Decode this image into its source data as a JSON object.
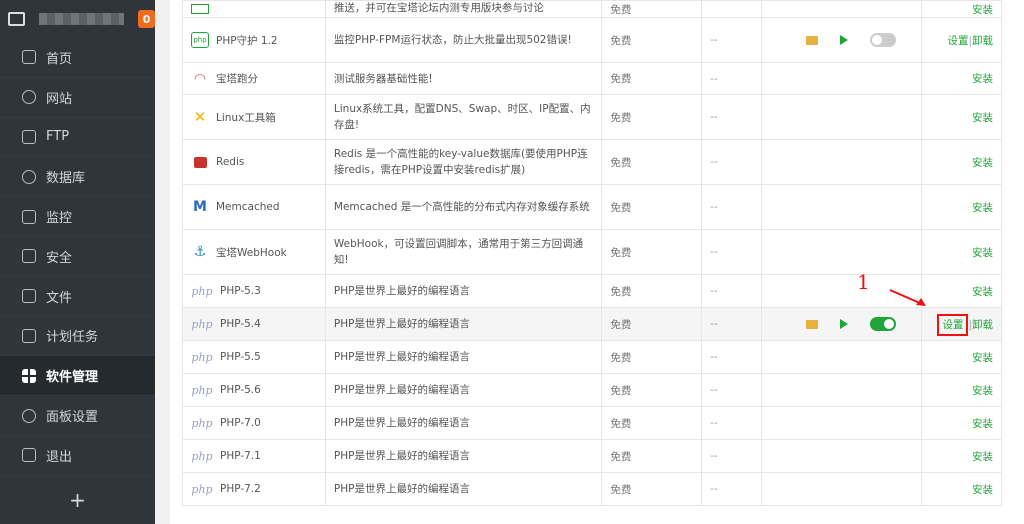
{
  "sidebar": {
    "badge": "0",
    "menu": [
      {
        "label": "首页",
        "icon": "home-icon"
      },
      {
        "label": "网站",
        "icon": "globe-icon"
      },
      {
        "label": "FTP",
        "icon": "ftp-icon"
      },
      {
        "label": "数据库",
        "icon": "database-icon"
      },
      {
        "label": "监控",
        "icon": "monitor-icon"
      },
      {
        "label": "安全",
        "icon": "shield-icon"
      },
      {
        "label": "文件",
        "icon": "folder-icon"
      },
      {
        "label": "计划任务",
        "icon": "calendar-icon"
      },
      {
        "label": "软件管理",
        "icon": "grid-icon",
        "active": true
      },
      {
        "label": "面板设置",
        "icon": "gear-icon"
      },
      {
        "label": "退出",
        "icon": "logout-icon"
      }
    ],
    "add": "+"
  },
  "rows": [
    {
      "name": "",
      "desc": "推送，并可在宝塔论坛内测专用版块参与讨论",
      "price": "免费",
      "expire": "",
      "action": "安装"
    },
    {
      "name": "PHP守护 1.2",
      "desc": "监控PHP-FPM运行状态，防止大批量出现502错误!",
      "price": "免费",
      "expire": "--",
      "action1": "设置",
      "sep": "|",
      "action2": "卸载"
    },
    {
      "name": "宝塔跑分",
      "desc": "测试服务器基础性能!",
      "price": "免费",
      "expire": "--",
      "action": "安装"
    },
    {
      "name": "Linux工具箱",
      "desc": "Linux系统工具，配置DNS、Swap、时区、IP配置、内存盘!",
      "price": "免费",
      "expire": "--",
      "action": "安装"
    },
    {
      "name": "Redis",
      "desc": "Redis 是一个高性能的key-value数据库(要使用PHP连接redis，需在PHP设置中安装redis扩展)",
      "price": "免费",
      "expire": "--",
      "action": "安装"
    },
    {
      "name": "Memcached",
      "desc": "Memcached 是一个高性能的分布式内存对象缓存系统",
      "price": "免费",
      "expire": "--",
      "action": "安装"
    },
    {
      "name": "宝塔WebHook",
      "desc": "WebHook，可设置回调脚本，通常用于第三方回调通知!",
      "price": "免费",
      "expire": "--",
      "action": "安装"
    },
    {
      "name": "PHP-5.3",
      "desc": "PHP是世界上最好的编程语言",
      "price": "免费",
      "expire": "--",
      "action": "安装"
    },
    {
      "name": "PHP-5.4",
      "desc": "PHP是世界上最好的编程语言",
      "price": "免费",
      "expire": "--",
      "action1": "设置",
      "sep": "|",
      "action2": "卸载"
    },
    {
      "name": "PHP-5.5",
      "desc": "PHP是世界上最好的编程语言",
      "price": "免费",
      "expire": "--",
      "action": "安装"
    },
    {
      "name": "PHP-5.6",
      "desc": "PHP是世界上最好的编程语言",
      "price": "免费",
      "expire": "--",
      "action": "安装"
    },
    {
      "name": "PHP-7.0",
      "desc": "PHP是世界上最好的编程语言",
      "price": "免费",
      "expire": "--",
      "action": "安装"
    },
    {
      "name": "PHP-7.1",
      "desc": "PHP是世界上最好的编程语言",
      "price": "免费",
      "expire": "--",
      "action": "安装"
    },
    {
      "name": "PHP-7.2",
      "desc": "PHP是世界上最好的编程语言",
      "price": "免费",
      "expire": "--",
      "action": "安装"
    }
  ],
  "php_icon_text": "php",
  "annotation": "1",
  "colors": {
    "accent": "#20a53a",
    "sidebar": "#2f353b",
    "badge": "#f06b1e",
    "annotation": "#ee1111"
  }
}
